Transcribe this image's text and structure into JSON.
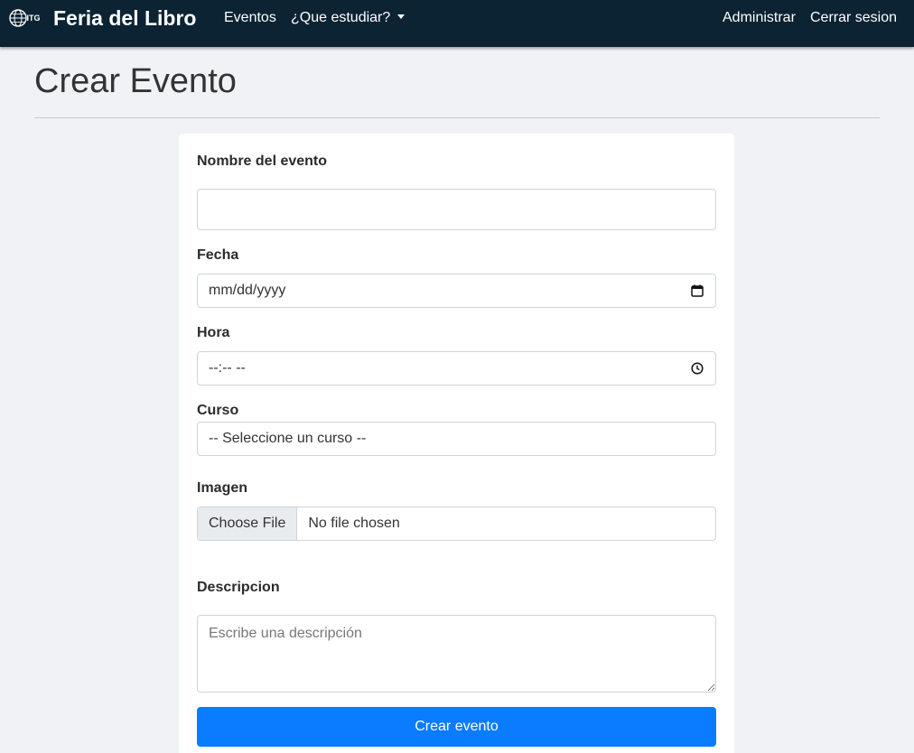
{
  "navbar": {
    "logo_text": "ITG",
    "brand": "Feria del Libro",
    "links": {
      "eventos": "Eventos",
      "que_estudiar": "¿Que estudiar?",
      "administrar": "Administrar",
      "cerrar_sesion": "Cerrar sesion"
    }
  },
  "page": {
    "title": "Crear Evento"
  },
  "form": {
    "nombre": {
      "label": "Nombre del evento",
      "value": ""
    },
    "fecha": {
      "label": "Fecha",
      "value": "mm/dd/yyyy",
      "icon": "calendar-icon"
    },
    "hora": {
      "label": "Hora",
      "value": "--:-- --",
      "icon": "clock-icon"
    },
    "curso": {
      "label": "Curso",
      "selected": "-- Seleccione un curso --"
    },
    "imagen": {
      "label": "Imagen",
      "button": "Choose File",
      "status": "No file chosen"
    },
    "descripcion": {
      "label": "Descripcion",
      "placeholder": "Escribe una descripción",
      "value": ""
    },
    "submit": "Crear evento"
  },
  "colors": {
    "navbar_bg": "#0b2333",
    "page_bg": "#f1f2f6",
    "primary_button": "#0a7cff"
  }
}
